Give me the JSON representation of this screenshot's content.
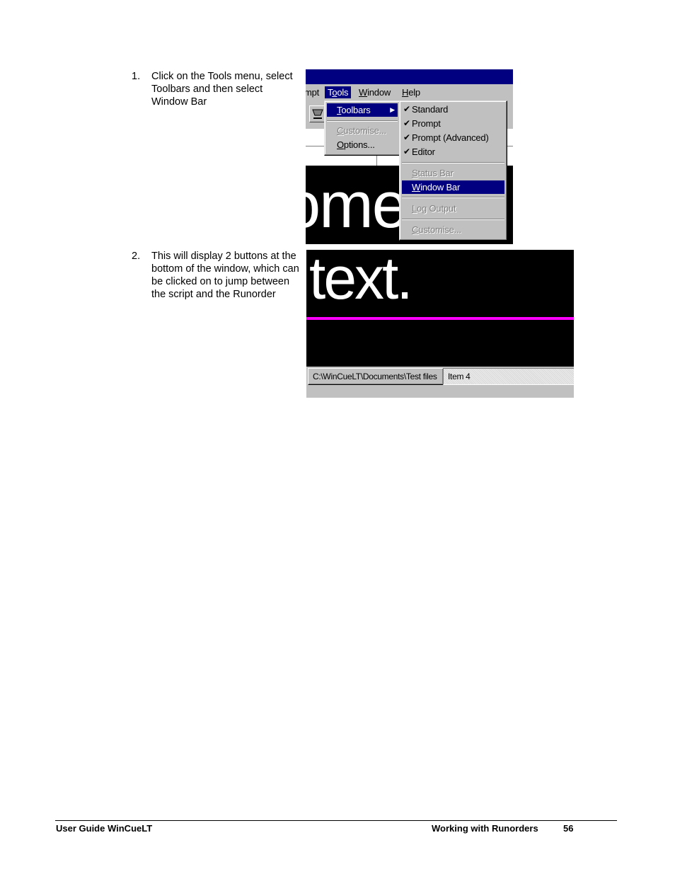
{
  "steps": [
    {
      "number": "1.",
      "text": "Click on the Tools menu, select Toolbars and then select Window Bar"
    },
    {
      "number": "2.",
      "text": "This will display 2 buttons at the bottom of the window, which can be clicked on to jump between the script and the Runorder"
    }
  ],
  "screenshot1": {
    "menubar": [
      {
        "label": "mpt",
        "underline": "",
        "rest": "mpt"
      },
      {
        "label": "Tools",
        "pre": "T",
        "underline": "o",
        "rest": "ols",
        "active": true
      },
      {
        "label": "Window",
        "pre": "",
        "underline": "W",
        "rest": "indow"
      },
      {
        "label": "Help",
        "pre": "",
        "underline": "H",
        "rest": "elp"
      }
    ],
    "tools_menu": [
      {
        "pre": "",
        "underline": "T",
        "rest": "oolbars",
        "state": "selected",
        "submenu": true
      },
      {
        "pre": "",
        "underline": "C",
        "rest": "ustomise...",
        "state": "disabled"
      },
      {
        "pre": "",
        "underline": "O",
        "rest": "ptions...",
        "state": "normal"
      }
    ],
    "toolbars_menu": {
      "group1": [
        {
          "label": "Standard",
          "checked": true
        },
        {
          "label": "Prompt",
          "checked": true
        },
        {
          "label": "Prompt (Advanced)",
          "checked": true
        },
        {
          "label": "Editor",
          "checked": true
        }
      ],
      "status_bar": {
        "underline": "S",
        "rest": "tatus Bar",
        "state": "disabled"
      },
      "window_bar": {
        "underline": "W",
        "rest": "indow Bar",
        "state": "selected"
      },
      "log_output": {
        "underline": "L",
        "rest": "og Output",
        "state": "disabled"
      },
      "customise": {
        "underline": "C",
        "rest": "ustomise...",
        "state": "disabled"
      }
    },
    "background_text": "ome",
    "check_glyph": "✔",
    "arrow_glyph": "▶"
  },
  "screenshot2": {
    "background_text": "text.",
    "window_buttons": [
      {
        "label": "C:\\WinCueLT\\Documents\\Test files",
        "pressed": false
      },
      {
        "label": "Item 4",
        "pressed": true
      }
    ],
    "divider_color": "#ff00ff"
  },
  "footer": {
    "left": "User Guide WinCueLT",
    "section": "Working with Runorders",
    "page": "56"
  },
  "colors": {
    "menu_highlight": "#000080",
    "win_gray": "#c0c0c0",
    "disabled_text": "#808080"
  }
}
